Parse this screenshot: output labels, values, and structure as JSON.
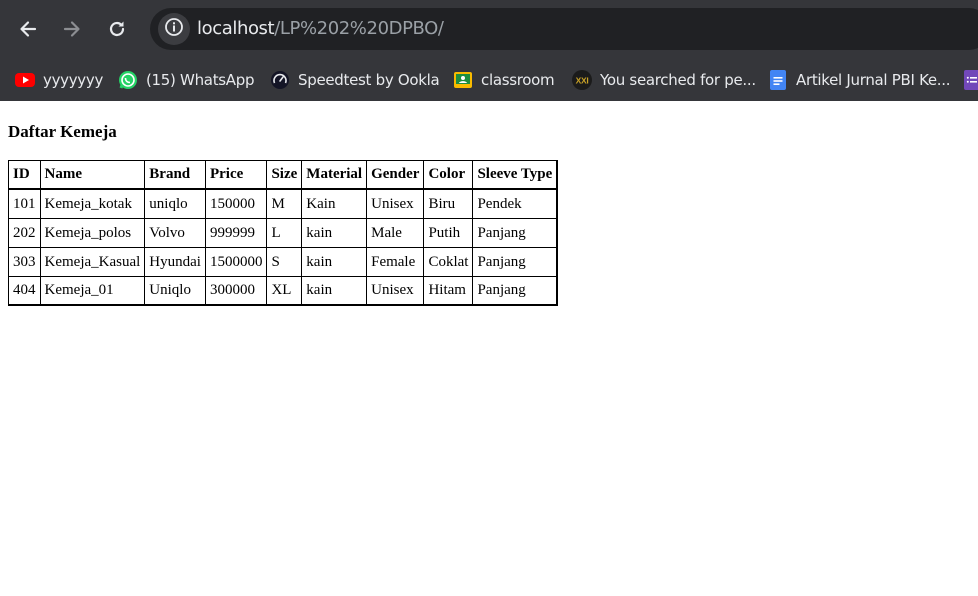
{
  "browser": {
    "url_host": "localhost",
    "url_path": "/LP%202%20DPBO/"
  },
  "bookmarks": [
    {
      "label": "yyyyyyy",
      "icon": "youtube-icon"
    },
    {
      "label": "(15) WhatsApp",
      "icon": "whatsapp-icon"
    },
    {
      "label": "Speedtest by Ookla",
      "icon": "speedtest-icon"
    },
    {
      "label": "classroom",
      "icon": "classroom-icon"
    },
    {
      "label": "You searched for pe...",
      "icon": "xxi-icon"
    },
    {
      "label": "Artikel Jurnal PBI Ke...",
      "icon": "google-docs-icon"
    },
    {
      "label": "",
      "icon": "google-forms-icon"
    }
  ],
  "page": {
    "title": "Daftar Kemeja",
    "table": {
      "headers": [
        "ID",
        "Name",
        "Brand",
        "Price",
        "Size",
        "Material",
        "Gender",
        "Color",
        "Sleeve Type"
      ],
      "rows": [
        [
          "101",
          "Kemeja_kotak",
          "uniqlo",
          "150000",
          "M",
          "Kain",
          "Unisex",
          "Biru",
          "Pendek"
        ],
        [
          "202",
          "Kemeja_polos",
          "Volvo",
          "999999",
          "L",
          "kain",
          "Male",
          "Putih",
          "Panjang"
        ],
        [
          "303",
          "Kemeja_Kasual",
          "Hyundai",
          "1500000",
          "S",
          "kain",
          "Female",
          "Coklat",
          "Panjang"
        ],
        [
          "404",
          "Kemeja_01",
          "Uniqlo",
          "300000",
          "XL",
          "kain",
          "Unisex",
          "Hitam",
          "Panjang"
        ]
      ]
    }
  },
  "colors": {
    "chrome_bg": "#35363a",
    "omnibox_bg": "#202124",
    "chrome_text": "#e8eaed",
    "url_path_text": "#9aa0a6"
  }
}
